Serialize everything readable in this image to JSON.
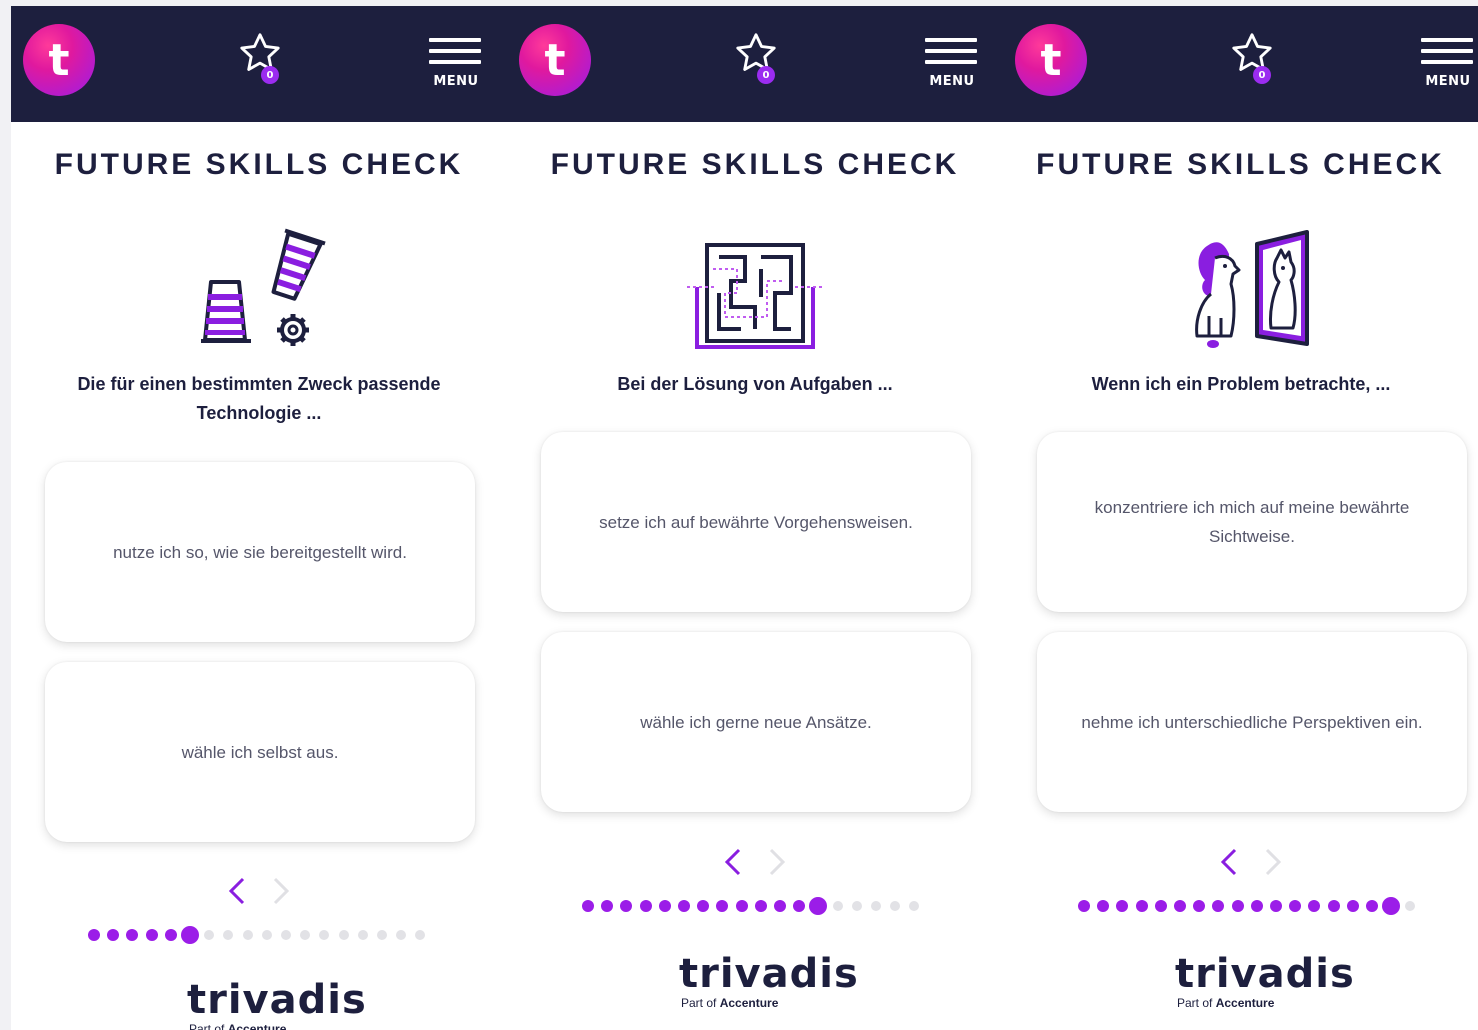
{
  "app": {
    "logo_letter": "t",
    "favorites_count": "0",
    "menu_label": "MENU",
    "title": "FUTURE SKILLS CHECK",
    "brand_name": "trivadis",
    "brand_sub_prefix": "Part of ",
    "brand_sub_company": "Accenture"
  },
  "colors": {
    "header_bg": "#1d1f3e",
    "accent": "#9b1de8",
    "dot_inactive": "#e2e2e6",
    "text_dark": "#1d1f3e",
    "text_answer": "#55566a"
  },
  "screens": [
    {
      "illustration": "stacked-cups-gear-icon",
      "question": "Die für einen bestimmten Zweck passende Technologie ...",
      "answers": [
        "nutze ich so, wie sie bereitgestellt wird.",
        "wähle ich selbst aus."
      ],
      "progress": {
        "total": 18,
        "current": 6
      }
    },
    {
      "illustration": "maze-icon",
      "question": "Bei der Lösung von Aufgaben ...",
      "answers": [
        "setze ich auf bewährte Vorgehensweisen.",
        "wähle ich gerne neue Ansätze."
      ],
      "progress": {
        "total": 18,
        "current": 13
      }
    },
    {
      "illustration": "lion-mirror-icon",
      "question": "Wenn ich ein Problem betrachte, ...",
      "answers": [
        "konzentriere ich mich auf meine bewährte Sichtweise.",
        "nehme ich unterschiedliche Perspektiven ein."
      ],
      "progress": {
        "total": 18,
        "current": 17
      }
    }
  ]
}
